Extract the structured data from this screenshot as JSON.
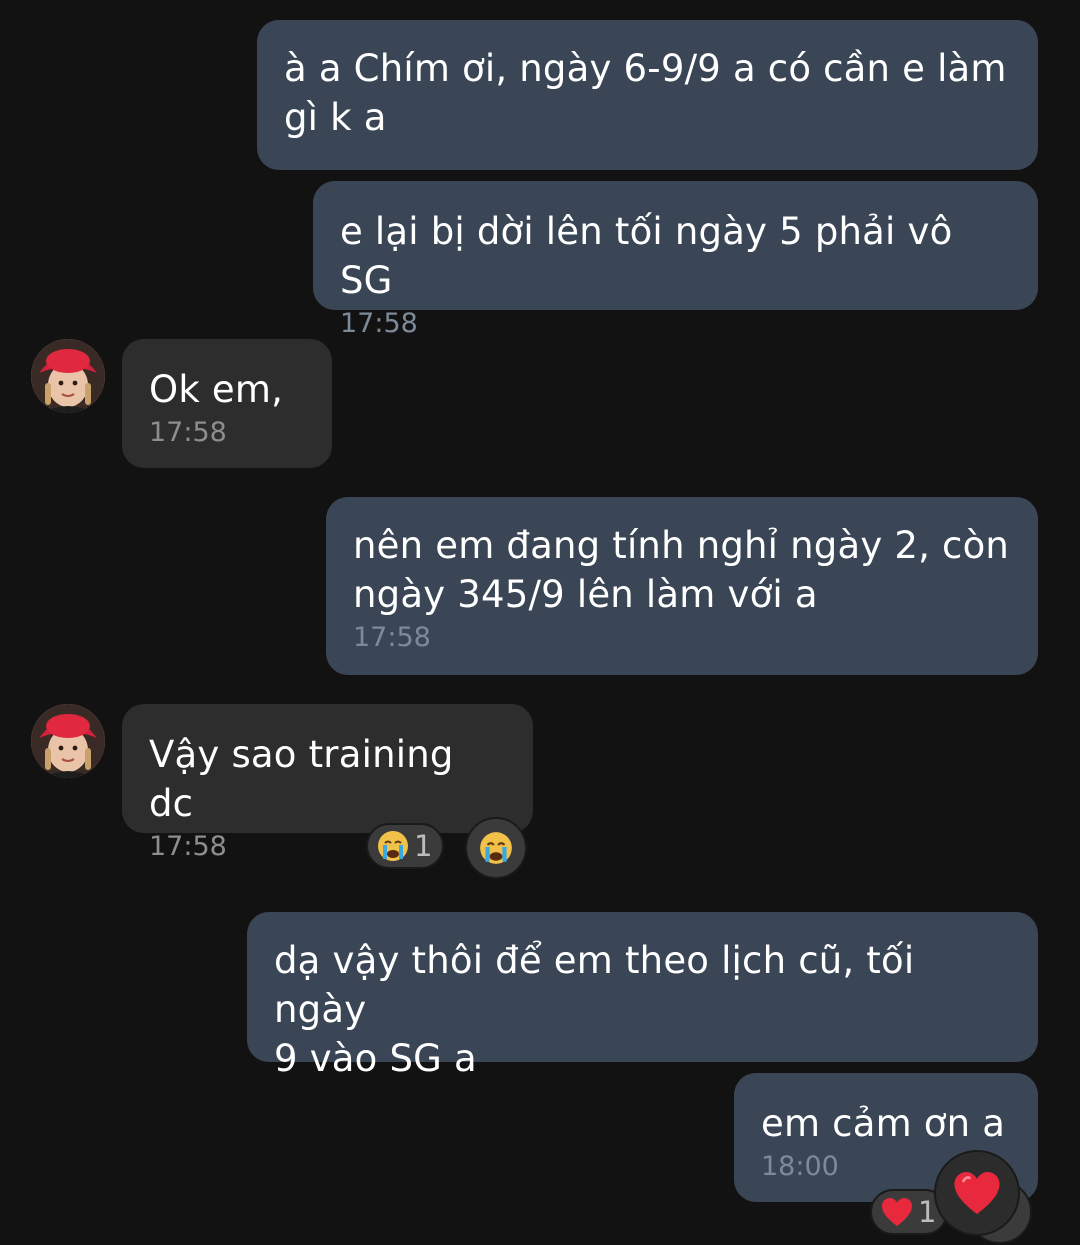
{
  "messages": [
    {
      "text": "à a Chím ơi, ngày 6-9/9 a có cần e làm\ngì k a",
      "time": ""
    },
    {
      "text": "e lại bị dời lên tối ngày 5 phải vô SG",
      "time": "17:58"
    },
    {
      "text": "Ok em,",
      "time": "17:58"
    },
    {
      "text": "nên em đang tính nghỉ ngày 2, còn\nngày 345/9 lên làm với a",
      "time": "17:58"
    },
    {
      "text": "Vậy sao training dc",
      "time": "17:58"
    },
    {
      "text": "dạ vậy thôi để em theo lịch cũ, tối ngày\n9 vào SG a",
      "time": ""
    },
    {
      "text": "em cảm ơn a",
      "time": "18:00"
    }
  ],
  "reactions": {
    "training": {
      "emoji": "crying-face",
      "count": "1"
    },
    "thanks": {
      "emoji": "red-heart",
      "count": "1"
    }
  },
  "colors": {
    "background": "#121212",
    "outgoing_bubble": "#3a4655",
    "incoming_bubble": "#2d2d2d",
    "heart": "#e8283c",
    "crying_face": "#f2c14a",
    "tears": "#39a9e0"
  }
}
